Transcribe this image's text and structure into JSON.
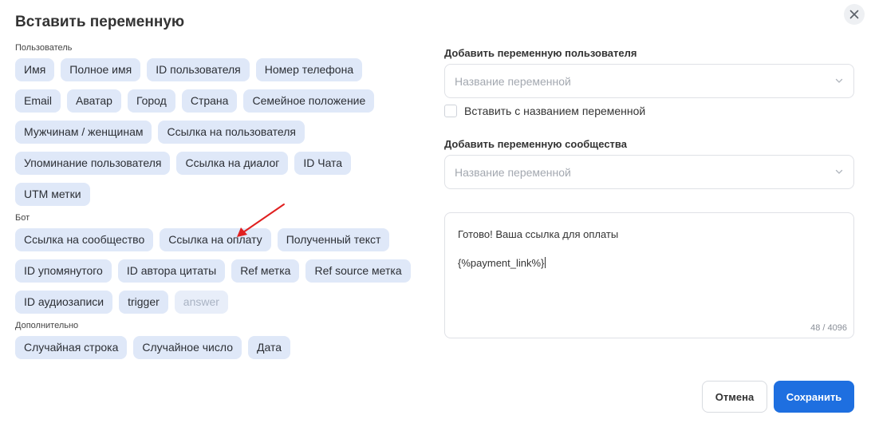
{
  "dialog": {
    "title": "Вставить переменную",
    "close_icon": "close-icon"
  },
  "sections": [
    {
      "label": "Пользователь",
      "chips": [
        "Имя",
        "Полное имя",
        "ID пользователя",
        "Номер телефона",
        "Email",
        "Аватар",
        "Город",
        "Страна",
        "Семейное положение",
        "Мужчинам / женщинам",
        "Ссылка на пользователя",
        "Упоминание пользователя",
        "Ссылка на диалог",
        "ID Чата",
        "UTM метки"
      ]
    },
    {
      "label": "Бот",
      "chips": [
        "Ссылка на сообщество",
        "Ссылка на оплату",
        "Полученный текст",
        "ID упомянутого",
        "ID автора цитаты",
        "Ref метка",
        "Ref source метка",
        "ID аудиозаписи",
        "trigger",
        "answer"
      ],
      "disabled": [
        "answer"
      ]
    },
    {
      "label": "Дополнительно",
      "chips": [
        "Случайная строка",
        "Случайное число",
        "Дата"
      ]
    }
  ],
  "user_variable": {
    "label": "Добавить переменную пользователя",
    "placeholder": "Название переменной",
    "checkbox_label": "Вставить с названием переменной",
    "checked": false
  },
  "community_variable": {
    "label": "Добавить переменную сообщества",
    "placeholder": "Название переменной"
  },
  "message": {
    "line1": "Готово! Ваша ссылка для оплаты",
    "line2": "{%payment_link%}",
    "counter": "48 / 4096"
  },
  "buttons": {
    "cancel": "Отмена",
    "save": "Сохранить"
  },
  "colors": {
    "chip_bg": "#dfe8f8",
    "primary": "#1e6fe0",
    "annotation_arrow": "#e02020"
  }
}
